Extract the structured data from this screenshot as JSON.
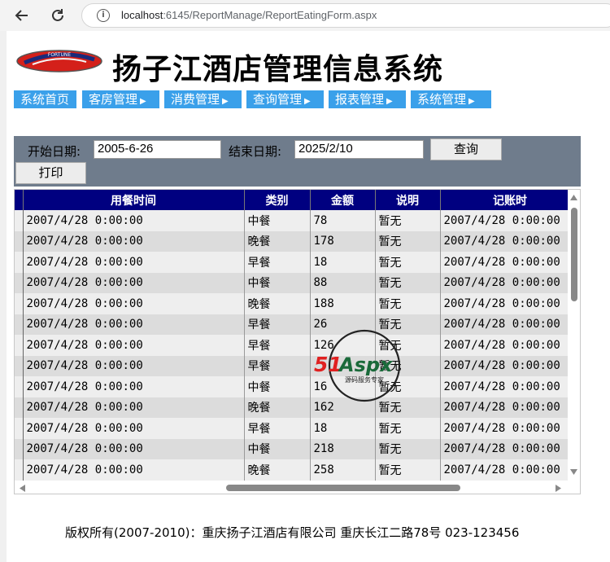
{
  "browser": {
    "url_host": "localhost",
    "url_rest": ":6145/ReportManage/ReportEatingForm.aspx"
  },
  "header": {
    "logo_text": "FORTUNE",
    "title": "扬子江酒店管理信息系统"
  },
  "menu": [
    {
      "label": "系统首页",
      "has_arrow": false
    },
    {
      "label": "客房管理",
      "has_arrow": true
    },
    {
      "label": "消费管理",
      "has_arrow": true
    },
    {
      "label": "查询管理",
      "has_arrow": true
    },
    {
      "label": "报表管理",
      "has_arrow": true
    },
    {
      "label": "系统管理",
      "has_arrow": true
    }
  ],
  "filter": {
    "start_label": "开始日期:",
    "start_value": "2005-6-26",
    "end_label": "结束日期:",
    "end_value": "2025/2/10",
    "query_button": "查询",
    "print_button": "打印"
  },
  "grid": {
    "columns": [
      "用餐时间",
      "类别",
      "金额",
      "说明",
      "记账时"
    ],
    "rows": [
      [
        "2007/4/28 0:00:00",
        "中餐",
        "78",
        "暂无",
        "2007/4/28 0:00:00"
      ],
      [
        "2007/4/28 0:00:00",
        "晚餐",
        "178",
        "暂无",
        "2007/4/28 0:00:00"
      ],
      [
        "2007/4/28 0:00:00",
        "早餐",
        "18",
        "暂无",
        "2007/4/28 0:00:00"
      ],
      [
        "2007/4/28 0:00:00",
        "中餐",
        "88",
        "暂无",
        "2007/4/28 0:00:00"
      ],
      [
        "2007/4/28 0:00:00",
        "晚餐",
        "188",
        "暂无",
        "2007/4/28 0:00:00"
      ],
      [
        "2007/4/28 0:00:00",
        "早餐",
        "26",
        "暂无",
        "2007/4/28 0:00:00"
      ],
      [
        "2007/4/28 0:00:00",
        "早餐",
        "126",
        "暂无",
        "2007/4/28 0:00:00"
      ],
      [
        "2007/4/28 0:00:00",
        "早餐",
        "",
        "暂无",
        "2007/4/28 0:00:00"
      ],
      [
        "2007/4/28 0:00:00",
        "中餐",
        "16",
        "暂无",
        "2007/4/28 0:00:00"
      ],
      [
        "2007/4/28 0:00:00",
        "晚餐",
        "162",
        "暂无",
        "2007/4/28 0:00:00"
      ],
      [
        "2007/4/28 0:00:00",
        "早餐",
        "18",
        "暂无",
        "2007/4/28 0:00:00"
      ],
      [
        "2007/4/28 0:00:00",
        "中餐",
        "218",
        "暂无",
        "2007/4/28 0:00:00"
      ],
      [
        "2007/4/28 0:00:00",
        "晚餐",
        "258",
        "暂无",
        "2007/4/28 0:00:00"
      ]
    ]
  },
  "watermark": {
    "brand": "51Aspx",
    "tagline": "源码服务专家"
  },
  "footer": {
    "text": "版权所有(2007-2010)：重庆扬子江酒店有限公司 重庆长江二路78号 023-123456"
  },
  "colors": {
    "menu_bg": "#3aa0ea",
    "grid_header": "#000080",
    "filter_bg": "#6f7c8c",
    "row_odd": "#eeeeee",
    "row_even": "#dcdcdc"
  }
}
